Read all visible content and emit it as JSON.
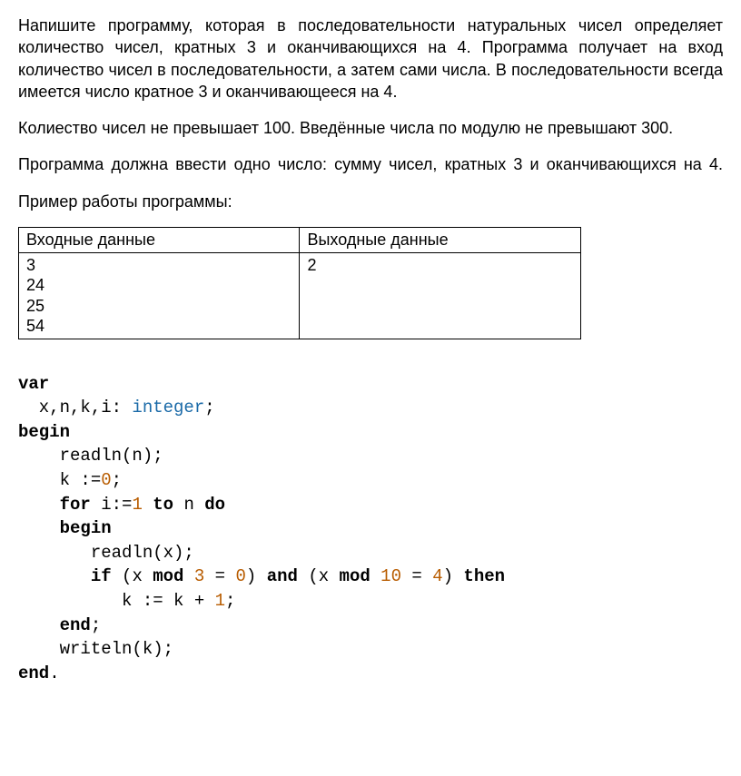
{
  "para1": "Напишите программу, которая в последовательности натуральных чисел определяет количество чисел, кратных 3 и оканчивающихся на 4. Программа получает на вход количество чисел в последовательности, а затем сами числа. В последовательности всегда имеется число кратное 3 и оканчивающееся на 4.",
  "para2": "Колиество чисел не превышает 100. Введённые числа по модулю не превышают 300.",
  "para3": "Программа должна ввести одно число: сумму чисел, кратных 3 и оканчивающихся на 4.",
  "para4": "Пример работы программы:",
  "table": {
    "header_in": "Входные данные",
    "header_out": "Выходные данные",
    "cell_in": "3\n24\n25\n54",
    "cell_out": "2"
  },
  "code": {
    "kw_var": "var",
    "decl1": "  x,n,k,i: ",
    "type_integer": "integer",
    "decl_end": ";",
    "kw_begin": "begin",
    "line_read_n": "    readln(n);",
    "line_k0_a": "    k :=",
    "num0": "0",
    "line_k0_b": ";",
    "line_for_a": "    ",
    "kw_for": "for",
    "line_for_b": " i:=",
    "num1": "1",
    "line_for_c": " ",
    "kw_to": "to",
    "line_for_d": " n ",
    "kw_do": "do",
    "line_begin2": "    ",
    "kw_begin2": "begin",
    "line_read_x": "       readln(x);",
    "line_if_a": "       ",
    "kw_if": "if",
    "line_if_b": " (x ",
    "kw_mod1": "mod",
    "line_if_c": " ",
    "num3": "3",
    "line_if_d": " = ",
    "num0b": "0",
    "line_if_e": ") ",
    "kw_and": "and",
    "line_if_f": " (x ",
    "kw_mod2": "mod",
    "line_if_g": " ",
    "num10": "10",
    "line_if_h": " = ",
    "num4": "4",
    "line_if_i": ") ",
    "kw_then": "then",
    "line_kplus_a": "          k := k + ",
    "num1b": "1",
    "line_kplus_b": ";",
    "line_end_a": "    ",
    "kw_end1": "end",
    "line_end_b": ";",
    "line_writeln": "    writeln(k);",
    "kw_end2": "end",
    "line_enddot": "."
  }
}
